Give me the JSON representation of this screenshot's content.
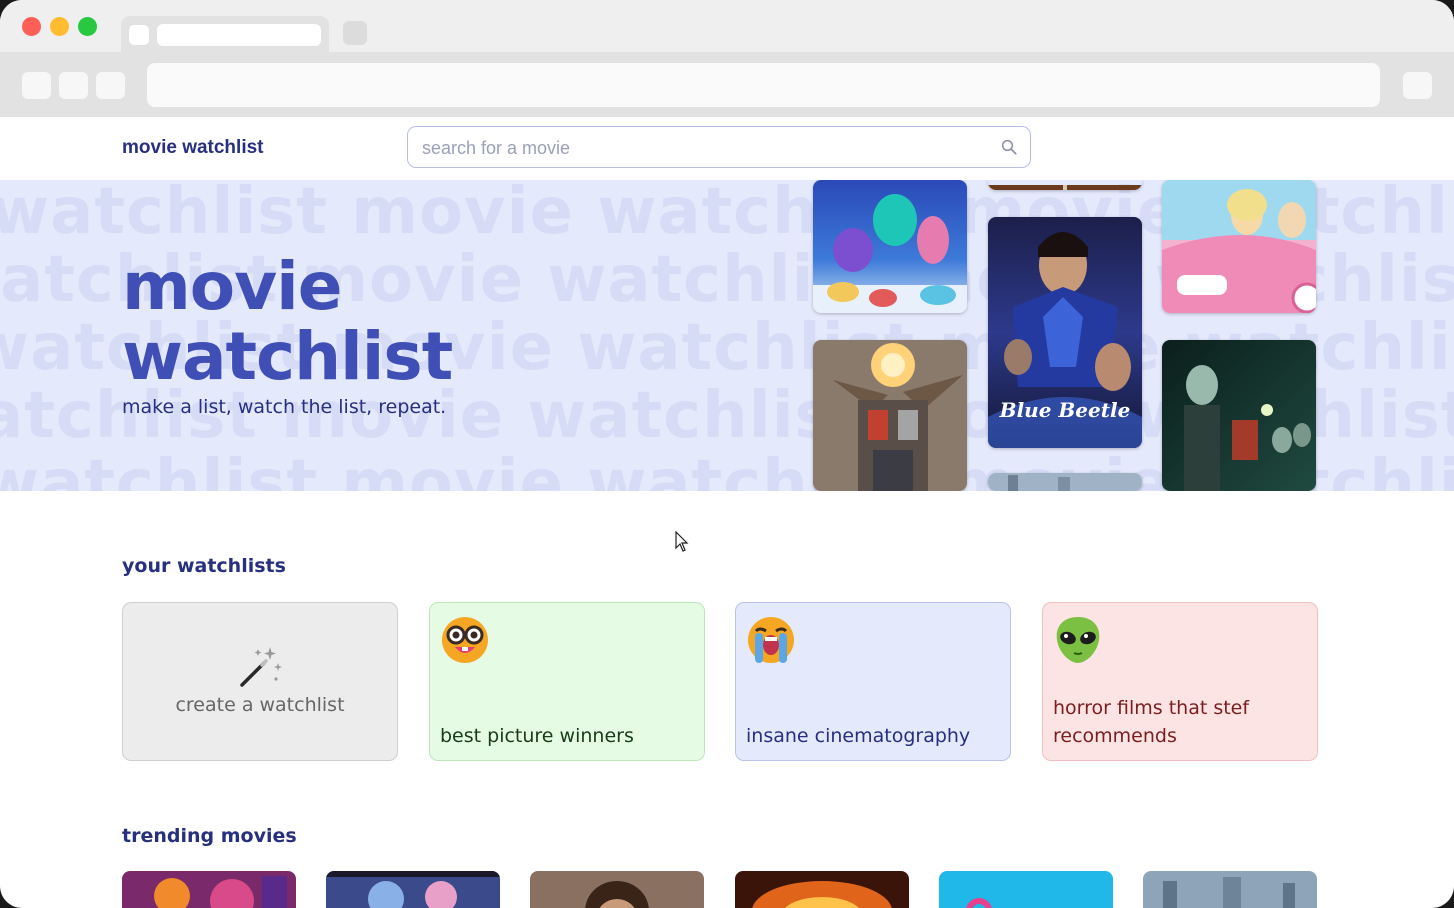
{
  "header": {
    "brand": "movie watchlist",
    "search_placeholder": "search for a movie"
  },
  "hero": {
    "title_line1": "movie",
    "title_line2": "watchlist",
    "subtitle": "make a list, watch the list, repeat.",
    "background_text": "watchlist movie watchlist movie watchlist movie watchlist movie"
  },
  "watchlists": {
    "heading": "your watchlists",
    "create_label": "create a watchlist",
    "items": [
      {
        "name": "best picture winners",
        "emoji": "nerd-face"
      },
      {
        "name": "insane cinematography",
        "emoji": "loudly-crying-face"
      },
      {
        "name": "horror films that stef recommends",
        "emoji": "alien"
      }
    ]
  },
  "trending": {
    "heading": "trending movies"
  },
  "posters": {
    "hero": [
      "Blue Beetle"
    ]
  },
  "colors": {
    "brand": "#26307f",
    "accent": "#3f4fb5",
    "hero_bg": "#e5e9fc",
    "green_card": "#e5fbe3",
    "blue_card": "#e5e9fc",
    "red_card": "#fde4e4",
    "grey_card": "#ececec"
  }
}
